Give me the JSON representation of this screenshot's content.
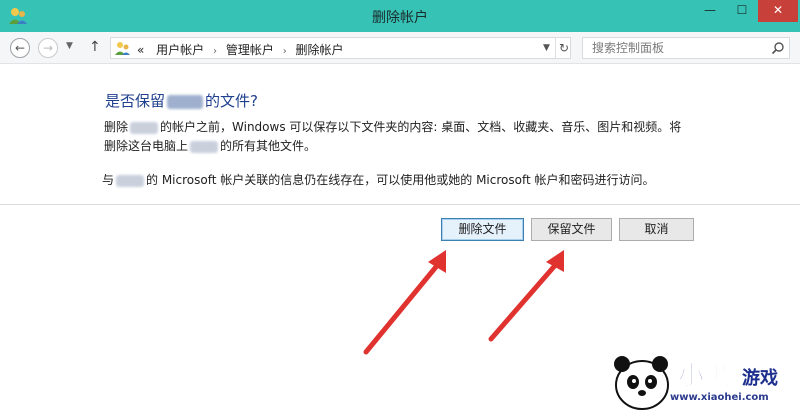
{
  "window": {
    "title": "删除帐户",
    "min_glyph": "—",
    "max_glyph": "☐",
    "close_glyph": "✕"
  },
  "nav": {
    "back_glyph": "←",
    "forward_glyph": "→",
    "dropdown_glyph": "▼",
    "up_glyph": "↑"
  },
  "address": {
    "prefix": "«",
    "separator": "›",
    "crumbs": [
      "用户帐户",
      "管理帐户",
      "删除帐户"
    ],
    "refresh_glyph": "↻"
  },
  "search": {
    "placeholder": "搜索控制面板"
  },
  "content": {
    "heading_prefix": "是否保留",
    "heading_suffix": "的文件?",
    "p1a_prefix": "删除",
    "p1a_suffix": "的帐户之前，Windows 可以保存以下文件夹的内容: 桌面、文档、收藏夹、音乐、图片和视频。将",
    "p1b_prefix": "删除这台电脑上",
    "p1b_suffix": "的所有其他文件。",
    "p2_prefix": "与",
    "p2_suffix": "的 Microsoft 帐户关联的信息仍在线存在，可以使用他或她的 Microsoft 帐户和密码进行访问。"
  },
  "buttons": {
    "delete_files": "删除文件",
    "keep_files": "保留文件",
    "cancel": "取消"
  },
  "colors": {
    "titlebar": "#37c2b6",
    "heading": "#1f3f8f",
    "arrow": "#e0322f",
    "close": "#c7403a"
  },
  "watermark": {
    "logo_text": "小黑游戏",
    "domain": "www.xiaohei.com"
  }
}
